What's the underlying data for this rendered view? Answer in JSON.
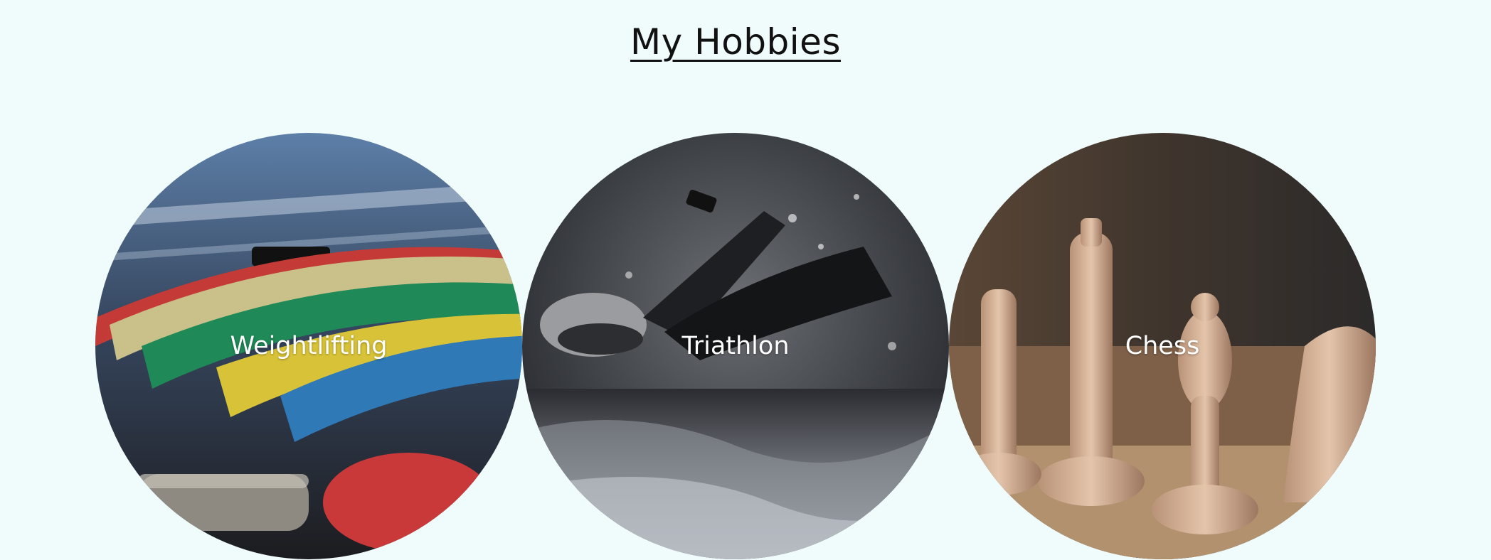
{
  "page": {
    "title": "My Hobbies"
  },
  "hobbies": [
    {
      "label": "Weightlifting",
      "image": "weight-plates-photo"
    },
    {
      "label": "Triathlon",
      "image": "swimmer-photo"
    },
    {
      "label": "Chess",
      "image": "chess-pieces-photo"
    }
  ],
  "colors": {
    "background": "#f0fcfc",
    "title_text": "#111111",
    "label_text": "#ffffff"
  }
}
